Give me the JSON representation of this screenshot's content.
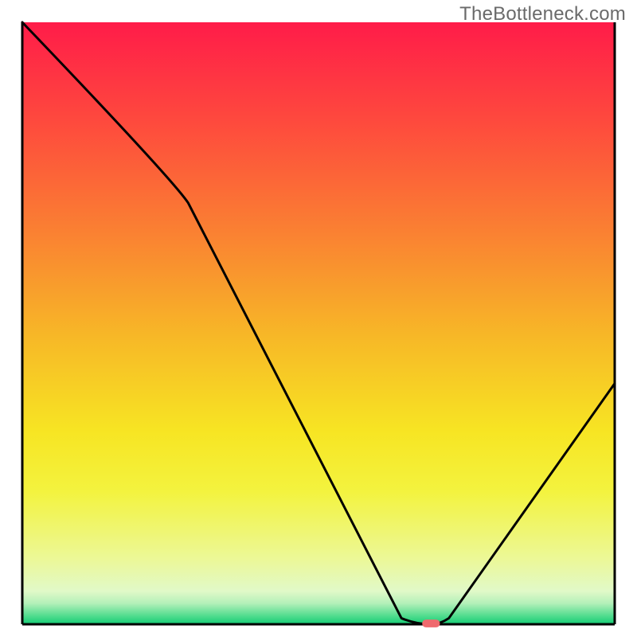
{
  "watermark": "TheBottleneck.com",
  "chart_data": {
    "type": "line",
    "title": "",
    "xlabel": "",
    "ylabel": "",
    "xlim": [
      0,
      100
    ],
    "ylim": [
      0,
      100
    ],
    "x": [
      0,
      28,
      64,
      69,
      72,
      100
    ],
    "values": [
      100,
      70,
      1,
      0,
      1,
      40
    ],
    "marker": {
      "x": 69,
      "y": 0,
      "color": "#ef6a6e",
      "width_frac": 0.03,
      "height_frac": 0.013
    },
    "grid": false,
    "legend": null,
    "gradient_stops": [
      {
        "offset": 0.0,
        "color": "#ff1c49"
      },
      {
        "offset": 0.17,
        "color": "#fe4b3d"
      },
      {
        "offset": 0.35,
        "color": "#fa8132"
      },
      {
        "offset": 0.52,
        "color": "#f7b727"
      },
      {
        "offset": 0.68,
        "color": "#f7e523"
      },
      {
        "offset": 0.78,
        "color": "#f3f33f"
      },
      {
        "offset": 0.89,
        "color": "#ecf896"
      },
      {
        "offset": 0.945,
        "color": "#e1f9c8"
      },
      {
        "offset": 0.965,
        "color": "#b4f0b9"
      },
      {
        "offset": 0.985,
        "color": "#56dd90"
      },
      {
        "offset": 1.0,
        "color": "#14cd75"
      }
    ],
    "frame": {
      "x_inset_frac": 0.035,
      "top_frac": 0.035,
      "bottom_frac": 0.02,
      "stroke": "#000000"
    }
  }
}
